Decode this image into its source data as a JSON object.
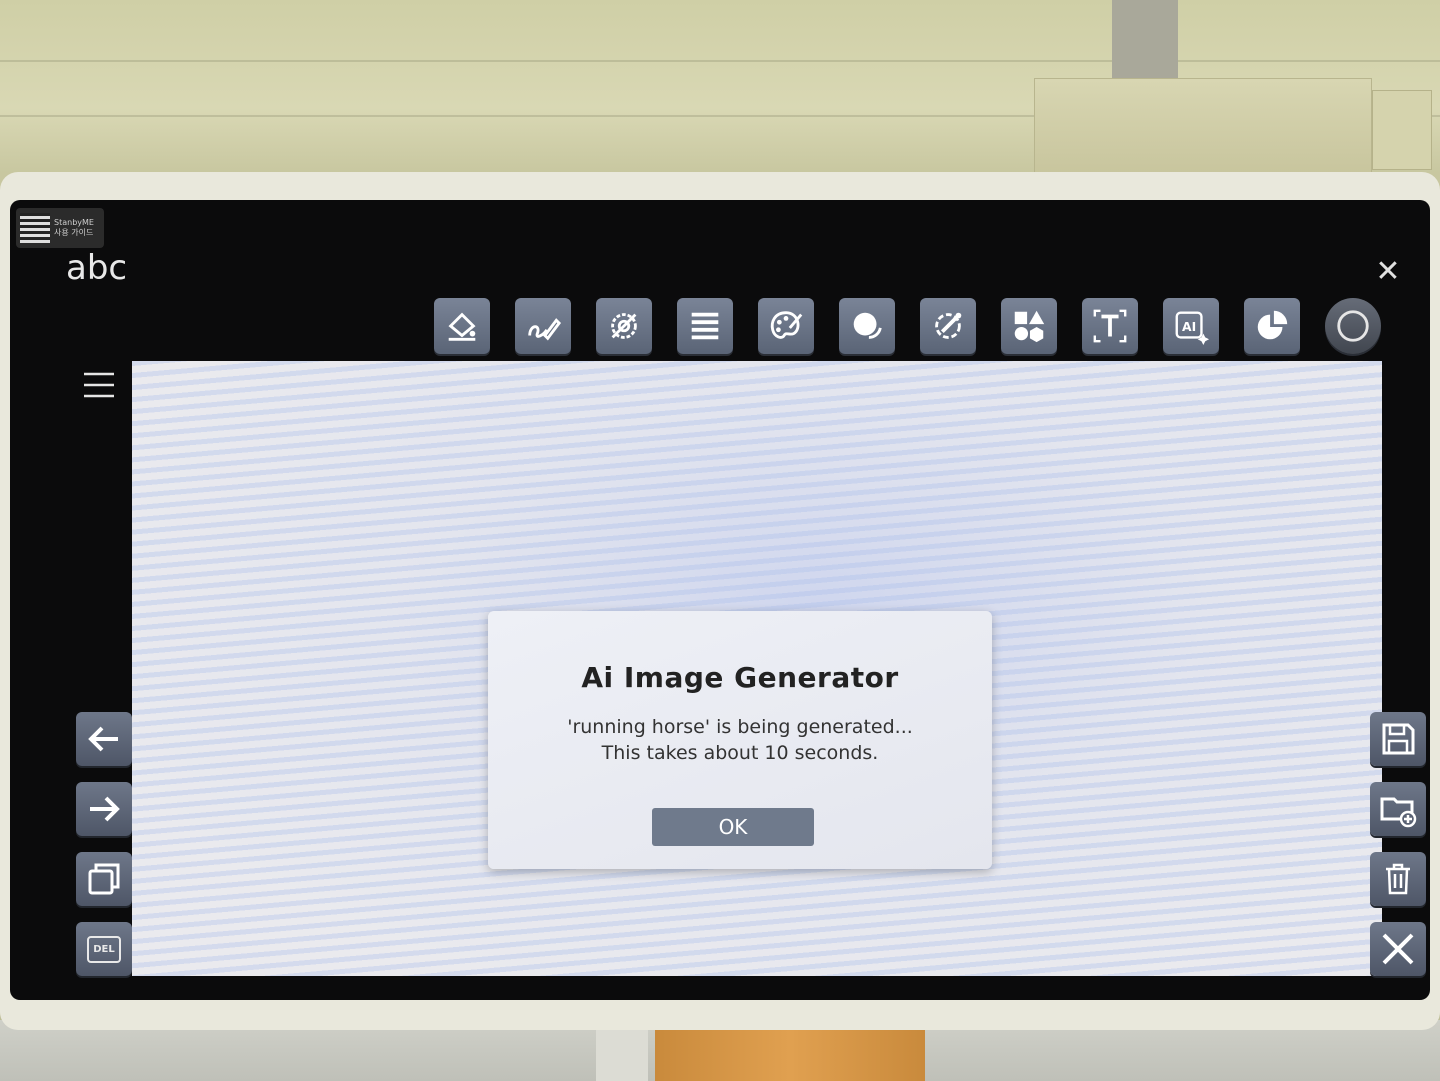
{
  "badge": {
    "brand": "StanbyME",
    "guide": "사용 가이드"
  },
  "document": {
    "title": "abc"
  },
  "toolbar": {
    "icons": [
      "paint-bucket-icon",
      "pen-icon",
      "settings-icon",
      "lines-icon",
      "palette-icon",
      "fill-circle-icon",
      "eyedropper-icon",
      "shapes-icon",
      "text-icon",
      "ai-icon",
      "pie-icon",
      "circle-icon"
    ]
  },
  "dialog": {
    "title": "Ai Image Generator",
    "message_line1": "'running horse' is being generated...",
    "message_line2": "This takes about 10 seconds.",
    "ok_label": "OK"
  },
  "left_controls": {
    "delete_label": "DEL"
  }
}
